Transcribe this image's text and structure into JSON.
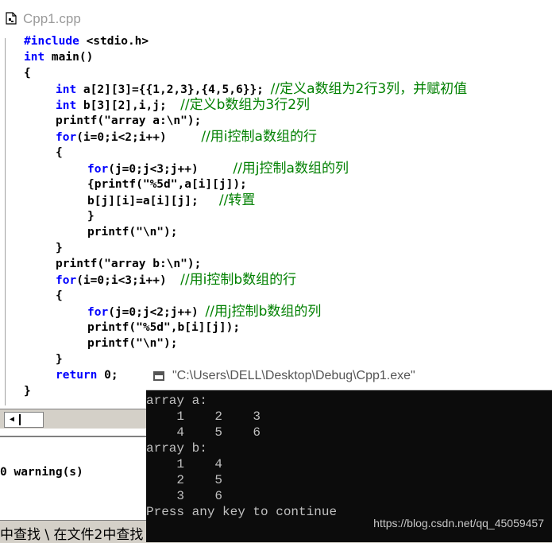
{
  "editor": {
    "file_title": "Cpp1.cpp"
  },
  "code": {
    "l1_kw": "#include",
    "l1_rest": " <stdio.h>",
    "l2_kw": "int",
    "l2_rest": " main()",
    "l3": "{",
    "l4_kw": "int",
    "l4_rest": " a[2][3]={{1,2,3},{4,5,6}}; ",
    "l4_cm": "//定义a数组为2行3列，并赋初值",
    "l5_kw": "int",
    "l5_rest": " b[3][2],i,j;  ",
    "l5_cm": "//定义b数组为3行2列",
    "l6": "printf(\"array a:\\n\");",
    "l7_kw": "for",
    "l7_rest": "(i=0;i<2;i++)     ",
    "l7_cm": "//用i控制a数组的行",
    "l8": "{",
    "l9_kw": "for",
    "l9_rest": "(j=0;j<3;j++)     ",
    "l9_cm": "//用j控制a数组的列",
    "l10": "{printf(\"%5d\",a[i][j]);",
    "l11_rest": "b[j][i]=a[i][j];   ",
    "l11_cm": "//转置",
    "l12": "}",
    "l13": "printf(\"\\n\");",
    "l14": "}",
    "l15": "printf(\"array b:\\n\");",
    "l16_kw": "for",
    "l16_rest": "(i=0;i<3;i++)  ",
    "l16_cm": "//用i控制b数组的行",
    "l17": "{",
    "l18_kw": "for",
    "l18_rest": "(j=0;j<2;j++) ",
    "l18_cm": "//用j控制b数组的列",
    "l19": "printf(\"%5d\",b[i][j]);",
    "l20": "printf(\"\\n\");",
    "l21": "}",
    "l22_kw": "return",
    "l22_rest": " 0;",
    "l23": "}"
  },
  "output_pane": {
    "warnings": "0 warning(s)"
  },
  "bottom_tabs": {
    "text": "中查找 \\ 在文件2中查找"
  },
  "console": {
    "title": "\"C:\\Users\\DELL\\Desktop\\Debug\\Cpp1.exe\"",
    "lines": [
      "array a:",
      "    1    2    3",
      "    4    5    6",
      "array b:",
      "    1    4",
      "    2    5",
      "    3    6",
      "Press any key to continue"
    ]
  },
  "watermark": "https://blog.csdn.net/qq_45059457",
  "colors": {
    "keyword": "#0000ff",
    "comment": "#008000",
    "console_bg": "#0c0c0c",
    "console_text": "#c0c0c0"
  }
}
